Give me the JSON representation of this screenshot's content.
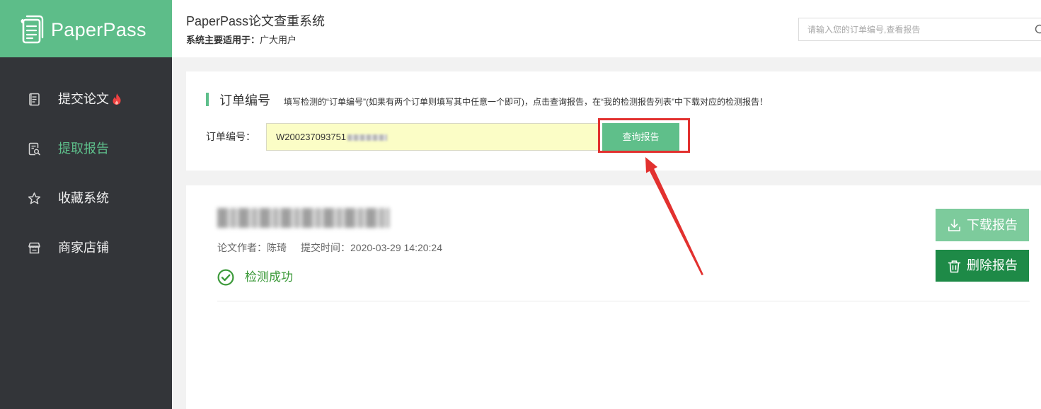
{
  "app": {
    "logo_text": "PaperPass",
    "title": "PaperPass论文查重系统",
    "subtitle_label": "系统主要适用于：",
    "subtitle_value": "广大用户"
  },
  "search": {
    "placeholder": "请输入您的订单编号,查看报告",
    "icon": "search-icon"
  },
  "sidebar": {
    "active_index": 1,
    "items": [
      {
        "label": "提交论文",
        "icon": "document-icon",
        "badge_icon": "fire-icon"
      },
      {
        "label": "提取报告",
        "icon": "report-search-icon"
      },
      {
        "label": "收藏系统",
        "icon": "star-icon"
      },
      {
        "label": "商家店铺",
        "icon": "store-icon"
      }
    ]
  },
  "query": {
    "section_title": "订单编号",
    "hint": "填写检测的“订单编号”(如果有两个订单则填写其中任意一个即可)，点击查询报告，在“我的检测报告列表”中下载对应的检测报告！",
    "field_label": "订单编号：",
    "order_value": "W200237093751",
    "button_label": "查询报告"
  },
  "report": {
    "author_label": "论文作者：",
    "author": "陈琦",
    "time_label": "提交时间：",
    "time": "2020-03-29 14:20:24",
    "status": "检测成功",
    "status_icon": "check-circle-icon",
    "download_label": "下载报告",
    "download_icon": "download-icon",
    "delete_label": "删除报告",
    "delete_icon": "trash-icon"
  },
  "colors": {
    "brand": "#5dbd89",
    "sidebar_bg": "#333539",
    "active_text": "#5ebf8b",
    "success": "#3c9a3a",
    "download_btn": "#7dcb9c",
    "delete_btn": "#1e8a47",
    "order_input_bg": "#fbfdc6",
    "annotation": "#e2312f"
  }
}
